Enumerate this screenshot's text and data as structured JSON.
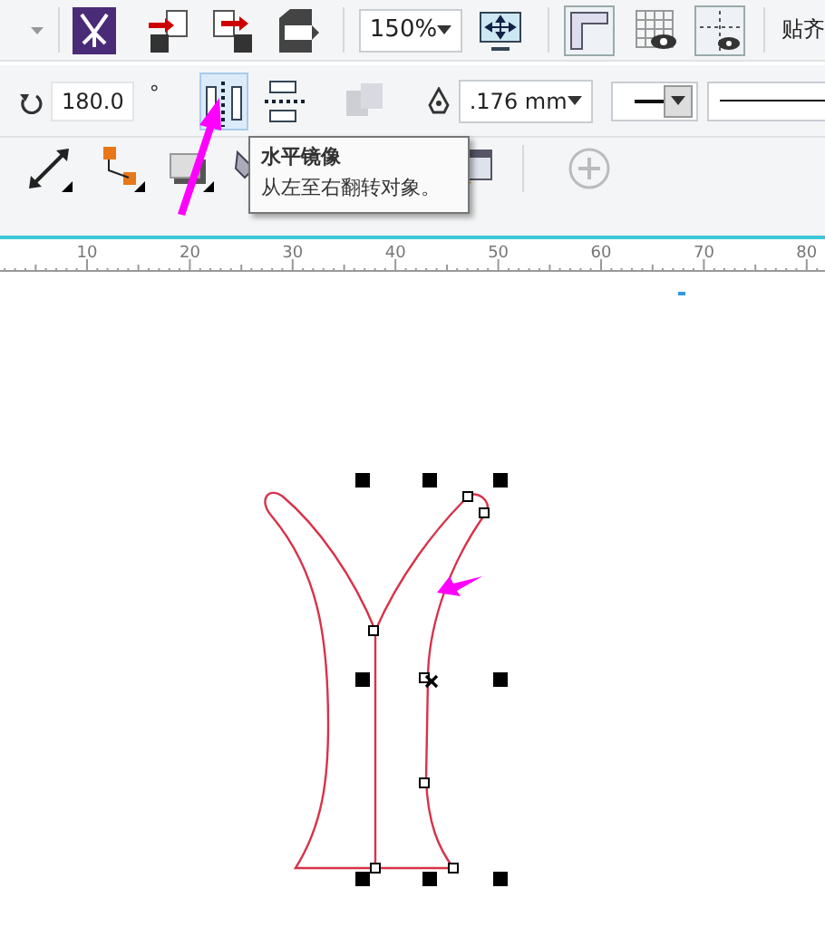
{
  "top_toolbar": {
    "zoom": {
      "value": "150%"
    },
    "snap_label": "贴齐"
  },
  "property_bar": {
    "rotation": {
      "value": "180.0",
      "unit": "°"
    },
    "mirror_buttons": [
      {
        "kind": "horizontal",
        "selected": true
      },
      {
        "kind": "vertical",
        "selected": false
      }
    ],
    "combine_button": {
      "disabled": true
    },
    "outline_width": {
      "value": ".176 mm"
    }
  },
  "tooltip": {
    "title": "水平镜像",
    "description": "从左至右翻转对象。"
  },
  "ruler": {
    "labels": [
      "10",
      "20",
      "30",
      "40",
      "50",
      "60",
      "70",
      "80"
    ]
  }
}
